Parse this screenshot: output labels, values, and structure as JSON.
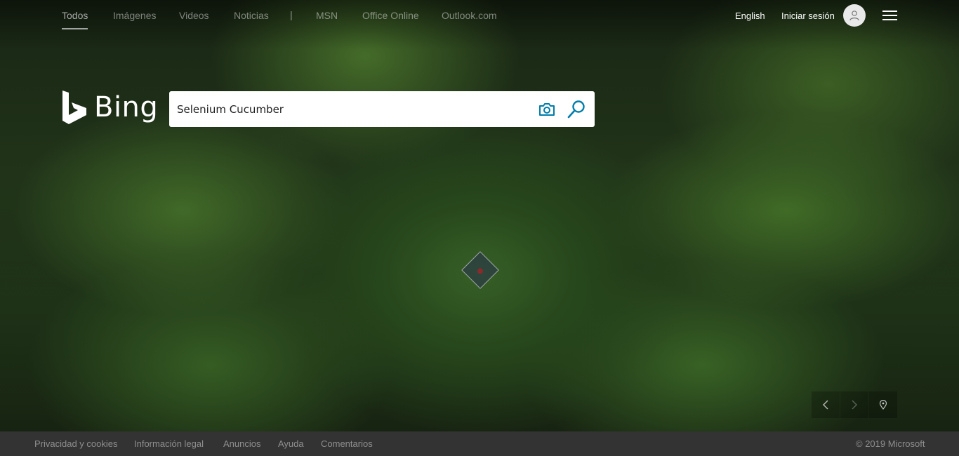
{
  "nav": {
    "scopes": [
      "Todos",
      "Imágenes",
      "Videos",
      "Noticias",
      "|",
      "MSN",
      "Office Online",
      "Outlook.com"
    ],
    "language": "English",
    "sign_in": "Iniciar sesión"
  },
  "logo": {
    "text": "Bing"
  },
  "search": {
    "value": "Selenium Cucumber"
  },
  "footer": {
    "links": [
      "Privacidad y cookies",
      "Información legal",
      "Anuncios",
      "Ayuda",
      "Comentarios"
    ],
    "copyright": "© 2019 Microsoft"
  },
  "icons": {
    "camera": "camera-icon",
    "search": "search-icon",
    "avatar": "user-icon",
    "menu": "hamburger-icon",
    "prev": "chevron-left-icon",
    "next": "chevron-right-icon",
    "location": "location-pin-icon"
  },
  "colors": {
    "accent": "#007daa",
    "footer_bg": "#333333"
  }
}
